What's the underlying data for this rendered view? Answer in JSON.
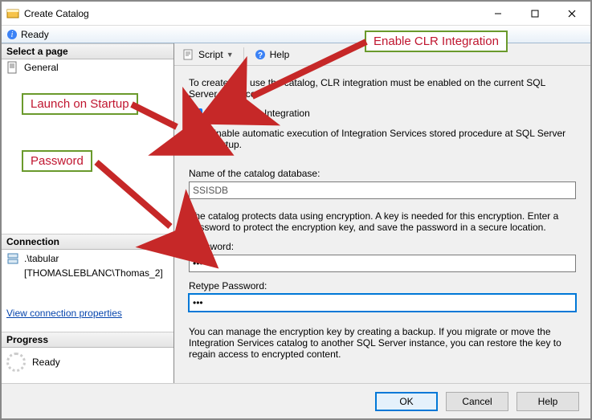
{
  "window": {
    "title": "Create Catalog"
  },
  "winbuttons": {
    "min": "—",
    "max": "☐",
    "close": "✕"
  },
  "status": {
    "text": "Ready"
  },
  "left": {
    "select_page_header": "Select a page",
    "nav_general": "General",
    "connection_header": "Connection",
    "connection_server": ".\\tabular",
    "connection_user": "[THOMASLEBLANC\\Thomas_2]",
    "view_props_link": "View connection properties",
    "progress_header": "Progress",
    "progress_text": "Ready"
  },
  "toolbar": {
    "script": "Script",
    "help": "Help"
  },
  "main": {
    "intro": "To create and use the catalog, CLR integration must be enabled on the current SQL Server instance.",
    "chk_clr": "Enable CLR Integration",
    "chk_auto": "Enable automatic execution of Integration Services stored procedure at SQL Server startup.",
    "dbname_label": "Name of the catalog database:",
    "dbname_value": "SSISDB",
    "encrypt_text": "The catalog protects data using encryption. A key is needed for this encryption. Enter a password to protect the encryption key, and save the password in a secure location.",
    "pwd_label": "Password:",
    "pwd_value": "••••",
    "pwd2_label": "Retype Password:",
    "pwd2_value": "•••",
    "backup_text": "You can manage the encryption key by creating a backup. If you migrate or move the Integration Services catalog to another SQL Server instance, you can restore the key to regain access to encrypted content."
  },
  "footer": {
    "ok": "OK",
    "cancel": "Cancel",
    "help": "Help"
  },
  "annotations": {
    "clr": "Enable CLR Integration",
    "launch": "Launch on Startup",
    "password": "Password"
  }
}
